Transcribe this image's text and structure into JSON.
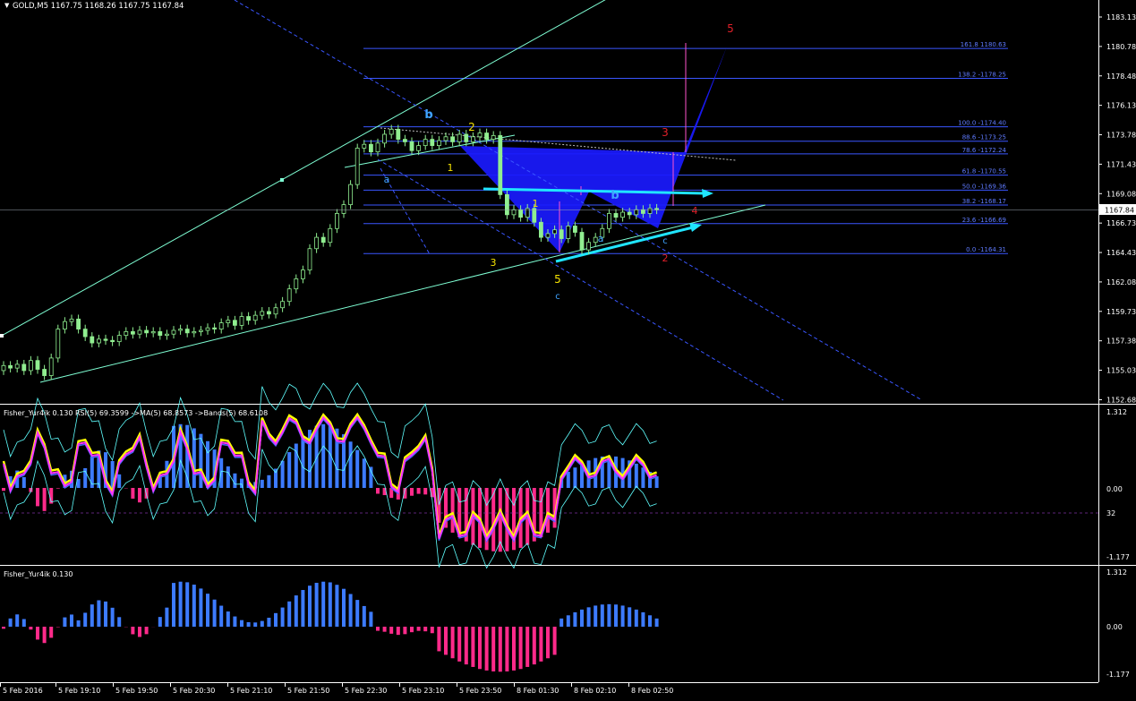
{
  "title_bar": {
    "arrow": "▼",
    "text": "GOLD,M5  1167.75 1168.26 1167.75 1167.84"
  },
  "main_axis": [
    "1183.13",
    "1180.78",
    "1178.48",
    "1176.13",
    "1173.78",
    "1171.43",
    "1169.08",
    "1166.73",
    "1164.43",
    "1162.08",
    "1159.73",
    "1157.38",
    "1155.03",
    "1152.68"
  ],
  "price_label": "1167.84",
  "fib_levels": [
    {
      "label": "161.8 1180.63",
      "price": 1180.63
    },
    {
      "label": "138.2 -1178.25",
      "price": 1178.25
    },
    {
      "label": "100.0 -1174.40",
      "price": 1174.4
    },
    {
      "label": "88.6 -1173.25",
      "price": 1173.25
    },
    {
      "label": "78.6 -1172.24",
      "price": 1172.24
    },
    {
      "label": "61.8 -1170.55",
      "price": 1170.55
    },
    {
      "label": "50.0 -1169.36",
      "price": 1169.36
    },
    {
      "label": "38.2 -1168.17",
      "price": 1168.17
    },
    {
      "label": "23.6 -1166.69",
      "price": 1166.69
    },
    {
      "label": "0.0 -1164.31",
      "price": 1164.31
    }
  ],
  "wave_labels": [
    {
      "text": "5",
      "color": "#e0202a"
    },
    {
      "text": "3",
      "color": "#e0202a"
    },
    {
      "text": "4",
      "color": "#e0202a"
    },
    {
      "text": "2",
      "color": "#e0202a"
    },
    {
      "text": "b",
      "color": "#3fa3ff"
    },
    {
      "text": "a",
      "color": "#3fa3ff"
    },
    {
      "text": "b",
      "color": "#3fa3ff"
    },
    {
      "text": "a",
      "color": "#3fa3ff"
    },
    {
      "text": "c",
      "color": "#3fa3ff"
    },
    {
      "text": "c",
      "color": "#3fa3ff"
    },
    {
      "text": "2",
      "color": "#f5e300"
    },
    {
      "text": "1",
      "color": "#f5e300"
    },
    {
      "text": "1",
      "color": "#f5e300"
    },
    {
      "text": "3",
      "color": "#f5e300"
    },
    {
      "text": "5",
      "color": "#f5e300"
    }
  ],
  "panel1": {
    "header": "Fisher_Yur4ik 0.130  RSI(5) 69.3599  ->MA(5) 68.8573  ->Bands(5) 68.6108",
    "axis": [
      "1.312",
      "0.00",
      "32",
      "-1.177"
    ]
  },
  "panel2": {
    "header": "Fisher_Yur4ik 0.130",
    "axis": [
      "1.312",
      "0.00",
      "-1.177"
    ]
  },
  "time_axis": [
    "5 Feb 2016",
    "5 Feb 19:10",
    "5 Feb 19:50",
    "5 Feb 20:30",
    "5 Feb 21:10",
    "5 Feb 21:50",
    "5 Feb 22:30",
    "5 Feb 23:10",
    "5 Feb 23:50",
    "8 Feb 01:30",
    "8 Feb 02:10",
    "8 Feb 02:50"
  ],
  "colors": {
    "background": "#000000",
    "bull_candle": "#90ee90",
    "fib": "#3a56ff",
    "trend": "#7fffd4",
    "pattern": "#1a1aff",
    "hist_pos": "#3d7bff",
    "hist_neg": "#ff2a8a",
    "rsi": "#ffff00",
    "ma": "#ff33ff",
    "bands": "#5fffff"
  }
}
